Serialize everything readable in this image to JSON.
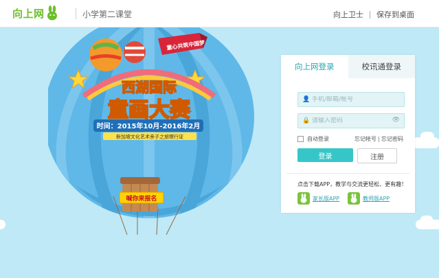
{
  "header": {
    "logo_text": "向上网",
    "subtitle": "小学第二课堂",
    "links": [
      "向上卫士",
      "保存到桌面"
    ]
  },
  "balloon": {
    "banner_top": "童心共筑中国梦",
    "title_line1": "西湖国际",
    "title_line2": "童画大赛",
    "date": "时间：2015年10月-2016年2月",
    "sponsor_line": "新加坡文化艺术亲子之旅赠行证",
    "basket_sign": "喊你来报名"
  },
  "login": {
    "tab_active": "向上网登录",
    "tab_inactive": "校讯通登录",
    "username_placeholder": "手机/邮箱/帐号",
    "password_placeholder": "请输入密码",
    "remember_label": "自动登录",
    "forgot_account": "忘记帐号",
    "forgot_password": "忘记密码",
    "login_button": "登录",
    "register_button": "注册",
    "promo_text": "点击下载APP，教学与交流更轻松、更有趣！",
    "apps": [
      "家长版APP",
      "教师版APP"
    ]
  },
  "colors": {
    "sky": "#bfe9f6",
    "accent": "#36c6c8",
    "logo_green": "#6cbf2a"
  }
}
